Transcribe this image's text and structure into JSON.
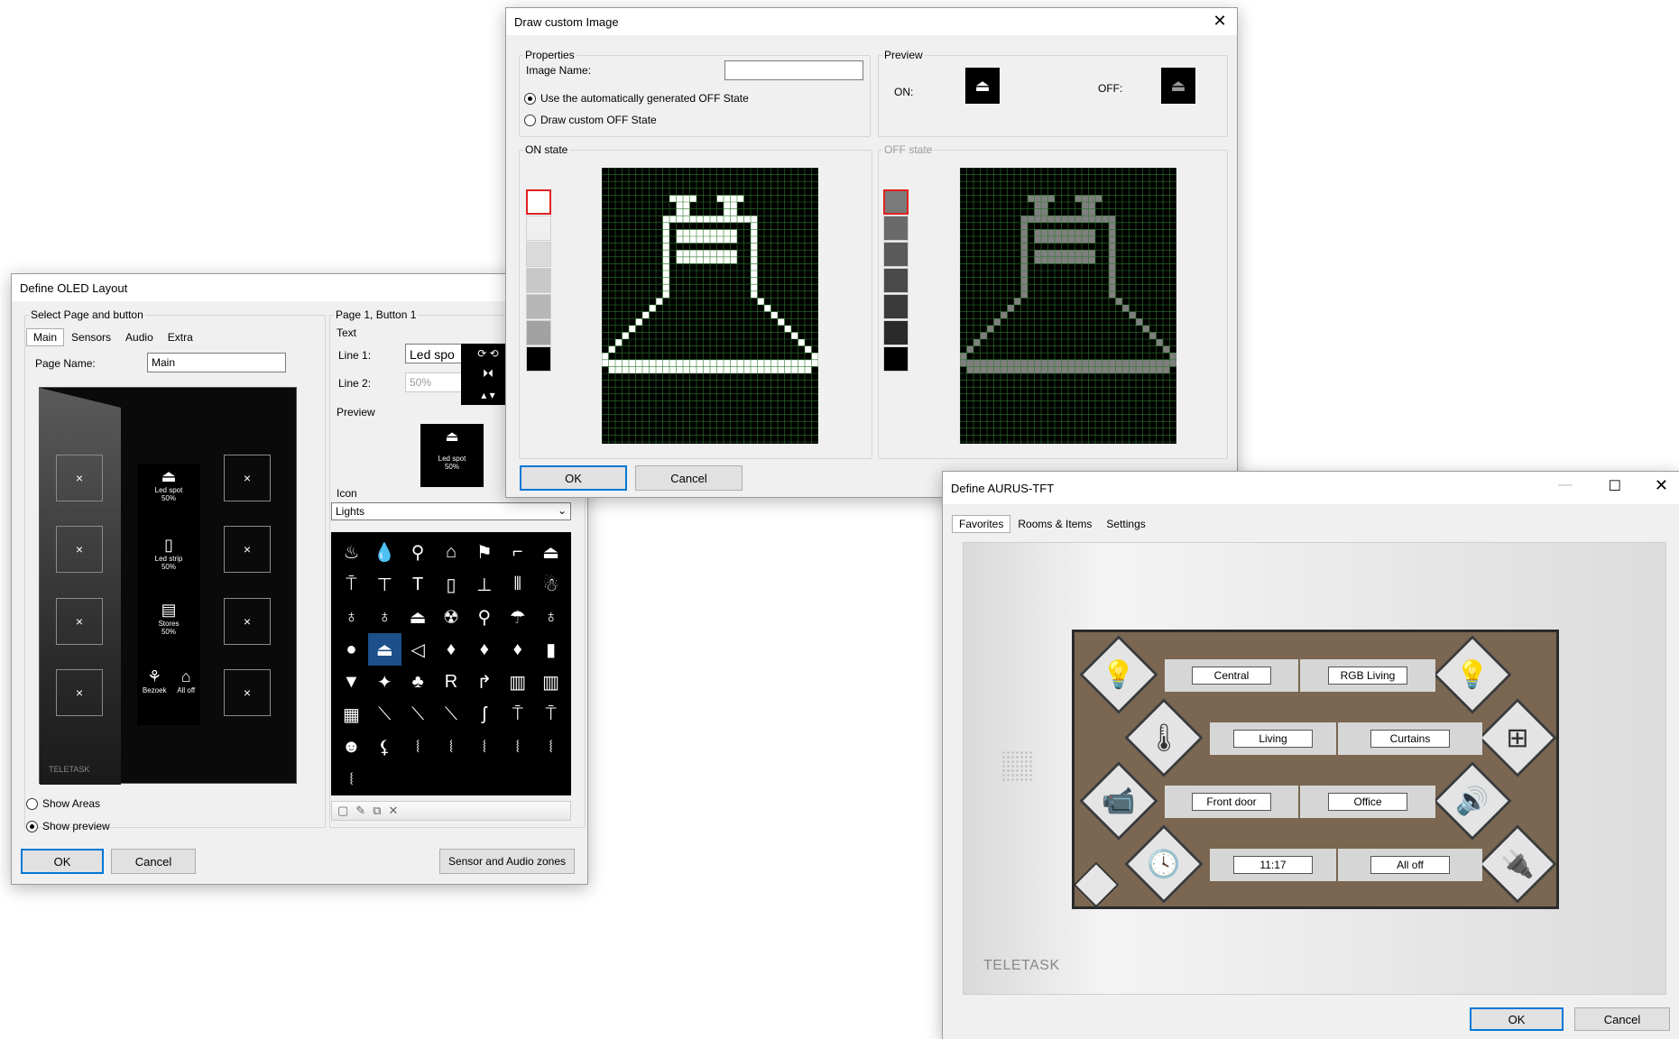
{
  "draw_dialog": {
    "title": "Draw custom Image",
    "properties_legend": "Properties",
    "image_name_label": "Image Name:",
    "image_name_value": "",
    "radio_auto_off": "Use the automatically generated OFF State",
    "radio_custom_off": "Draw custom OFF State",
    "preview_legend": "Preview",
    "on_label": "ON:",
    "off_label": "OFF:",
    "on_state_legend": "ON state",
    "off_state_legend": "OFF state",
    "ok": "OK",
    "cancel": "Cancel",
    "on_palette": [
      "#ffffff",
      "#efefef",
      "#dadada",
      "#c8c8c8",
      "#b6b6b6",
      "#a2a2a2",
      "#000000"
    ],
    "off_palette": [
      "#7a7a7a",
      "#6a6a6a",
      "#5a5a5a",
      "#4a4a4a",
      "#3a3a3a",
      "#2a2a2a",
      "#000000"
    ],
    "on_pixel_color": "#ffffff",
    "off_pixel_color": "#7f7f7f",
    "grid_line_color": "#2e7a2e",
    "selected_swatch_color": "#e02020"
  },
  "oled_dialog": {
    "title": "Define OLED Layout",
    "select_legend": "Select Page and button",
    "tabs": [
      "Main",
      "Sensors",
      "Audio",
      "Extra"
    ],
    "page_name_label": "Page Name:",
    "page_name_value": "Main",
    "button_legend": "Page 1, Button 1",
    "text_legend": "Text",
    "line1_label": "Line 1:",
    "line1_value": "Led spo",
    "line2_label": "Line 2:",
    "line2_value": "50%",
    "preview_legend": "Preview",
    "preview_line1": "Led spot",
    "preview_line2": "50%",
    "icon_legend": "Icon",
    "icon_category": "Lights",
    "panel_items": [
      {
        "line1": "Led spot",
        "line2": "50%"
      },
      {
        "line1": "Led strip",
        "line2": "50%"
      },
      {
        "line1": "Stores",
        "line2": "50%"
      }
    ],
    "bottom_labels": [
      "Bezoek",
      "All off"
    ],
    "brand": "TELETASK",
    "show_areas": "Show Areas",
    "show_preview": "Show preview",
    "ok": "OK",
    "cancel": "Cancel",
    "sensor_audio": "Sensor and Audio zones",
    "cell_mark": "×"
  },
  "tft_dialog": {
    "title": "Define AURUS-TFT",
    "tabs": [
      "Favorites",
      "Rooms & Items",
      "Settings"
    ],
    "rows": [
      {
        "left": "Central",
        "right": "RGB Living"
      },
      {
        "left": "Living",
        "right": "Curtains"
      },
      {
        "left": "Front door",
        "right": "Office"
      },
      {
        "left": "11:17",
        "right": "All off"
      }
    ],
    "brand": "TELETASK",
    "ok": "OK",
    "cancel": "Cancel",
    "panel_color": "#7a6651"
  }
}
